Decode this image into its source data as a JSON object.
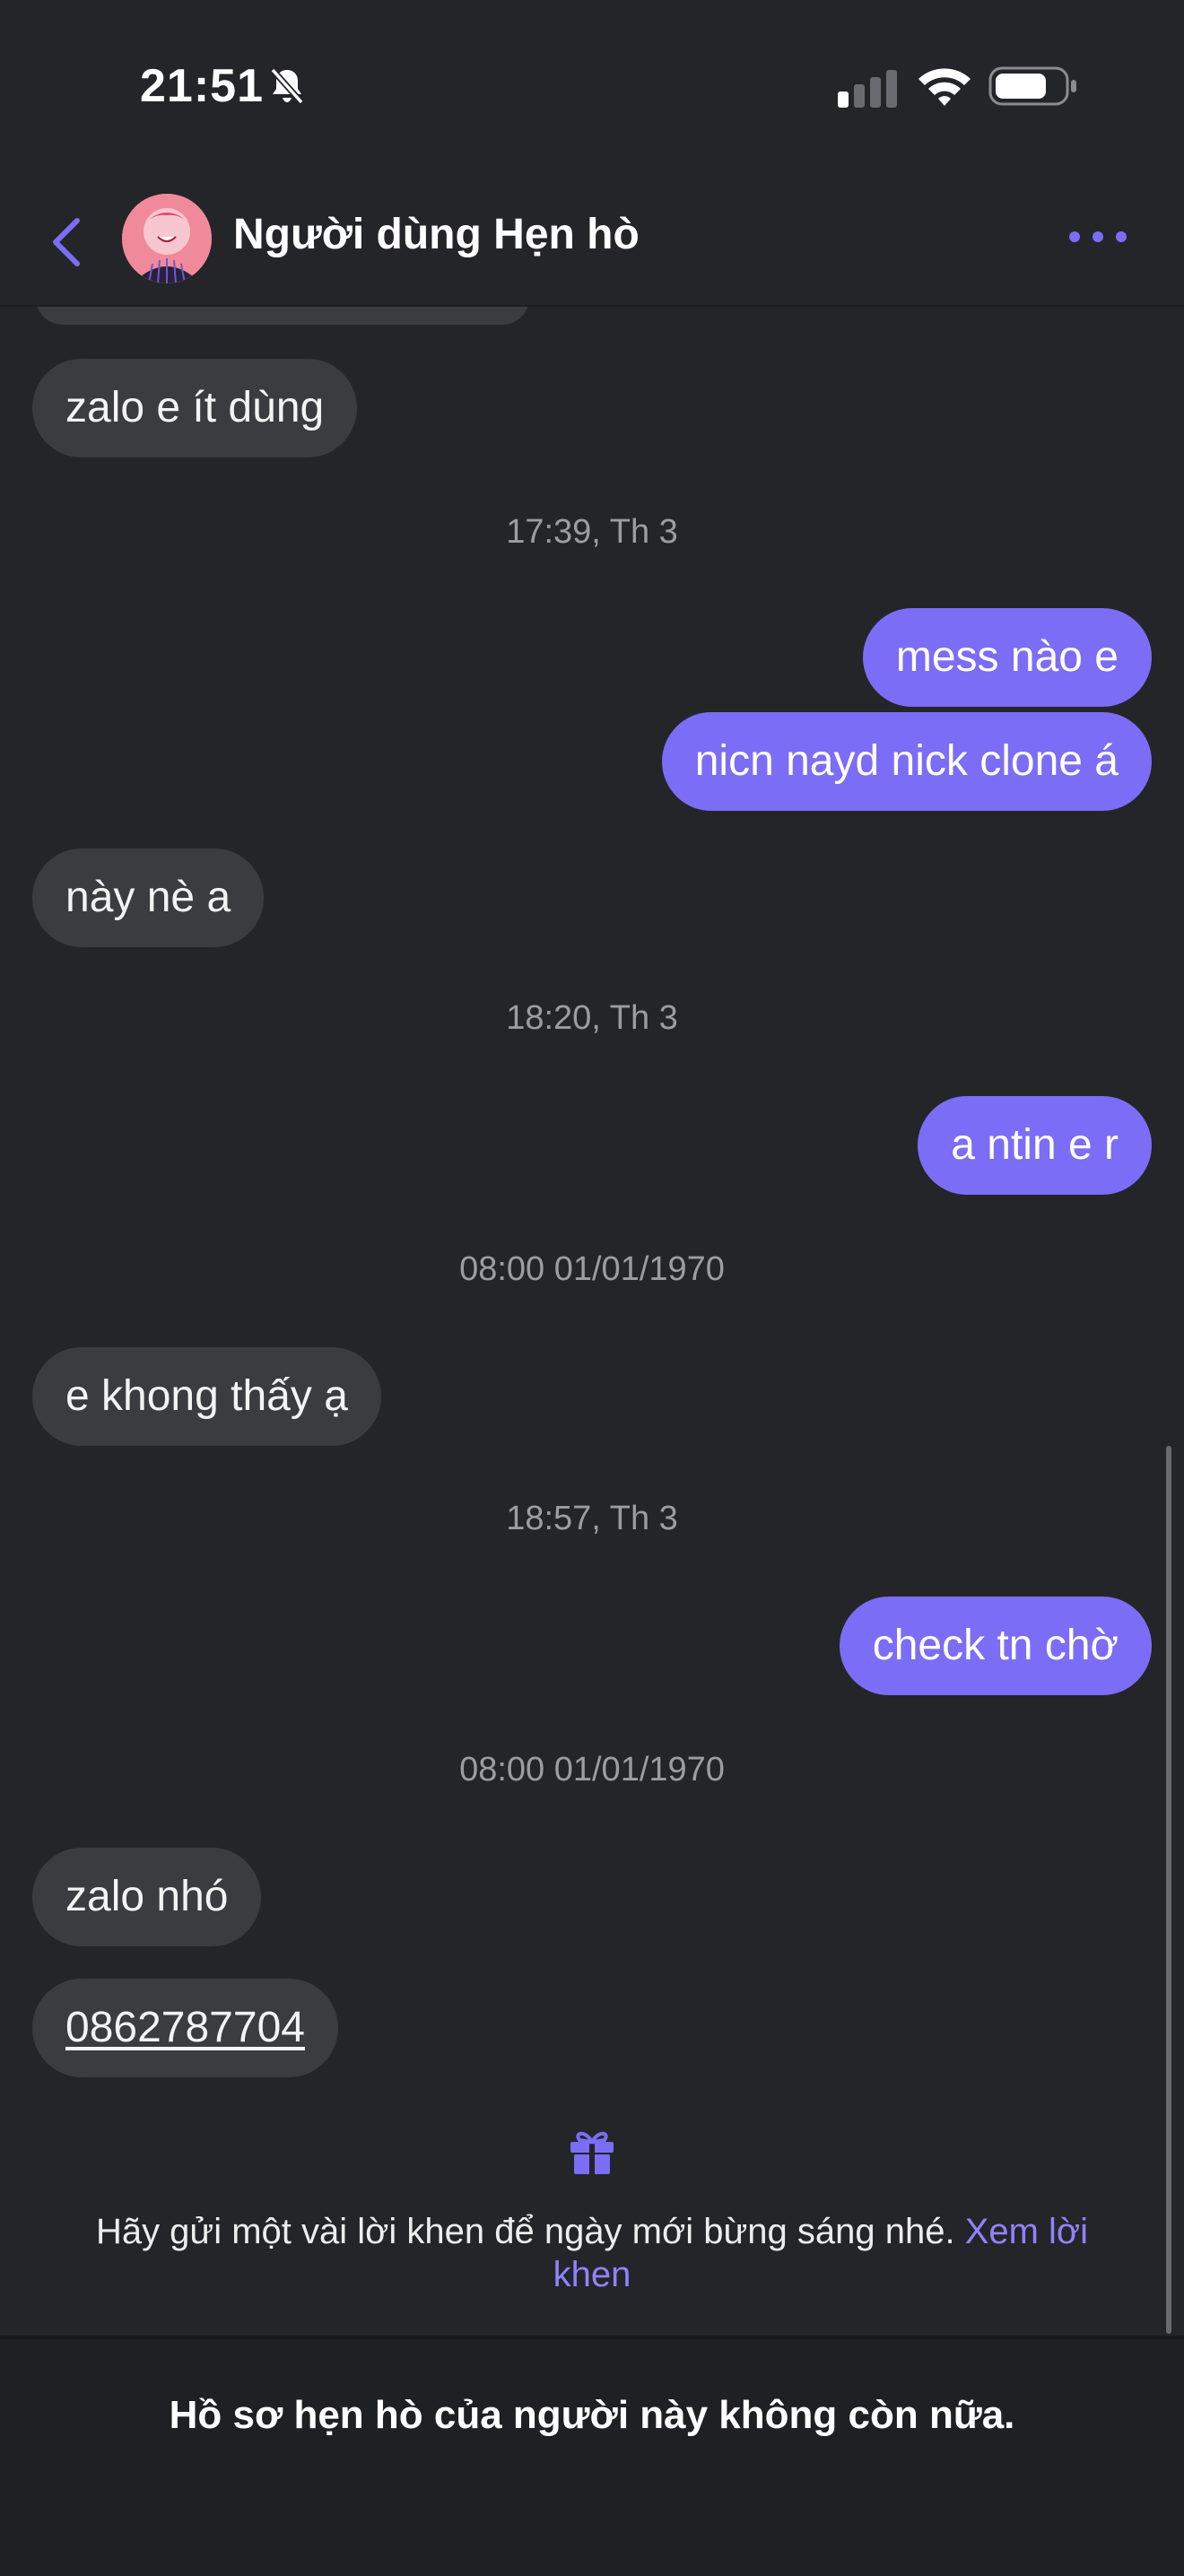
{
  "status_bar": {
    "time": "21:51"
  },
  "header": {
    "contact_name": "Người dùng Hẹn hò"
  },
  "messages": [
    {
      "text": "zalo e ít dùng"
    },
    {
      "time": "17:39, Th 3"
    },
    {
      "text": "mess nào e"
    },
    {
      "text": "nicn nayd nick clone á"
    },
    {
      "text": "này nè a"
    },
    {
      "time": "18:20, Th 3"
    },
    {
      "text": "a ntin e r"
    },
    {
      "time": "08:00 01/01/1970"
    },
    {
      "text": "e khong thấy ạ"
    },
    {
      "time": "18:57, Th 3"
    },
    {
      "text": "check tn chờ"
    },
    {
      "time": "08:00 01/01/1970"
    },
    {
      "text": "zalo nhó"
    },
    {
      "text": "0862787704"
    }
  ],
  "compliment": {
    "text": "Hãy gửi một vài lời khen để ngày mới bừng sáng nhé.",
    "link": "Xem lời khen"
  },
  "footer": {
    "notice": "Hồ sơ hẹn hò của người này không còn nữa."
  },
  "colors": {
    "background": "#242528",
    "incoming_bubble": "#3b3c40",
    "outgoing_bubble": "#7b6df6",
    "accent": "#8f83ff"
  },
  "icons": [
    "bell-slash-icon",
    "signal-icon",
    "wifi-icon",
    "battery-icon",
    "chevron-left-icon",
    "more-dots-icon",
    "gift-icon"
  ]
}
